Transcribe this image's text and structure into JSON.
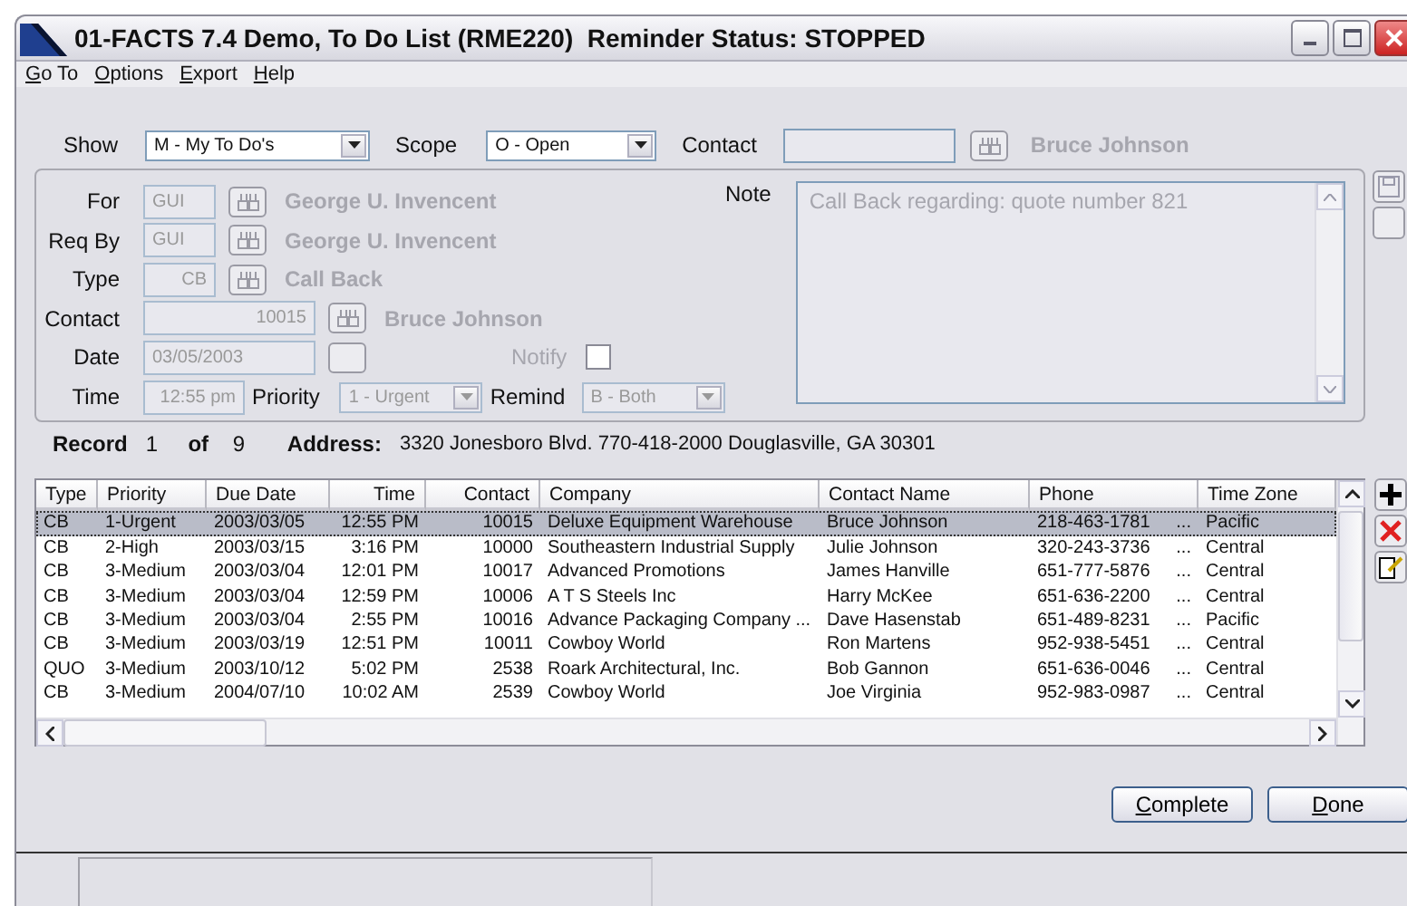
{
  "window": {
    "title": "01-FACTS 7.4 Demo, To Do List (RME220)  Reminder Status: STOPPED"
  },
  "menu": [
    "Go To",
    "Options",
    "Export",
    "Help"
  ],
  "filters": {
    "show": {
      "label": "Show",
      "value": "M - My To Do's"
    },
    "scope": {
      "label": "Scope",
      "value": "O - Open"
    },
    "contact": {
      "label": "Contact",
      "name": "Bruce Johnson"
    }
  },
  "form": {
    "disabled": true,
    "fields": [
      {
        "kind": "person",
        "label": "For",
        "value": "GUI",
        "name": "George U. Invencent"
      },
      {
        "kind": "person",
        "label": "Req By",
        "value": "GUI",
        "name": "George U. Invencent"
      },
      {
        "kind": "type",
        "label": "Type",
        "value": "CB",
        "name": "Call Back"
      },
      {
        "kind": "contact",
        "label": "Contact",
        "value": "10015",
        "name": "Bruce Johnson"
      },
      {
        "kind": "date",
        "label": "Date",
        "value": "03/05/2003",
        "notify_label": "Notify",
        "notify_checked": false
      },
      {
        "kind": "time",
        "label": "Time",
        "value": "12:55 pm",
        "priority_label": "Priority",
        "priority": "1 - Urgent",
        "remind_label": "Remind",
        "remind": "B - Both"
      }
    ],
    "note": {
      "label": "Note",
      "text": "Call Back regarding: quote number 821"
    }
  },
  "record": {
    "label": "Record",
    "index": "1",
    "of": "of",
    "total": "9",
    "address_label": "Address:",
    "address": "3320 Jonesboro Blvd. 770-418-2000 Douglasville, GA 30301"
  },
  "table": {
    "columns": [
      "Type",
      "Priority",
      "Due Date",
      "Time",
      "Contact",
      "Company",
      "Contact Name",
      "Phone",
      "Time Zone"
    ],
    "rows": [
      {
        "selected": true,
        "cells": [
          "CB",
          "1-Urgent",
          "2003/03/05",
          "12:55 PM",
          "10015",
          "Deluxe Equipment Warehouse",
          "Bruce Johnson",
          "218-463-1781",
          "Pacific"
        ],
        "more": "..."
      },
      {
        "selected": false,
        "cells": [
          "CB",
          "2-High",
          "2003/03/15",
          "3:16 PM",
          "10000",
          "Southeastern Industrial Supply",
          "Julie Johnson",
          "320-243-3736",
          "Central"
        ],
        "more": "..."
      },
      {
        "selected": false,
        "cells": [
          "CB",
          "3-Medium",
          "2003/03/04",
          "12:01 PM",
          "10017",
          "Advanced Promotions",
          "James Hanville",
          "651-777-5876",
          "Central"
        ],
        "more": "..."
      },
      {
        "selected": false,
        "cells": [
          "CB",
          "3-Medium",
          "2003/03/04",
          "12:59 PM",
          "10006",
          "A T S Steels Inc",
          "Harry McKee",
          "651-636-2200",
          "Central"
        ],
        "more": "..."
      },
      {
        "selected": false,
        "cells": [
          "CB",
          "3-Medium",
          "2003/03/04",
          "2:55 PM",
          "10016",
          "Advance Packaging Company ...",
          "Dave Hasenstab",
          "651-489-8231",
          "Pacific"
        ],
        "more": "..."
      },
      {
        "selected": false,
        "cells": [
          "CB",
          "3-Medium",
          "2003/03/19",
          "12:51 PM",
          "10011",
          "Cowboy World",
          "Ron Martens",
          "952-938-5451",
          "Central"
        ],
        "more": "..."
      },
      {
        "selected": false,
        "cells": [
          "QUO",
          "3-Medium",
          "2003/10/12",
          "5:02 PM",
          "2538",
          "Roark Architectural, Inc.",
          "Bob Gannon",
          "651-636-0046",
          "Central"
        ],
        "more": "..."
      },
      {
        "selected": false,
        "cells": [
          "CB",
          "3-Medium",
          "2004/07/10",
          "10:02 AM",
          "2539",
          "Cowboy World",
          "Joe Virginia",
          "952-983-0987",
          "Central"
        ],
        "more": "..."
      }
    ]
  },
  "buttons": [
    "Complete",
    "Done"
  ]
}
